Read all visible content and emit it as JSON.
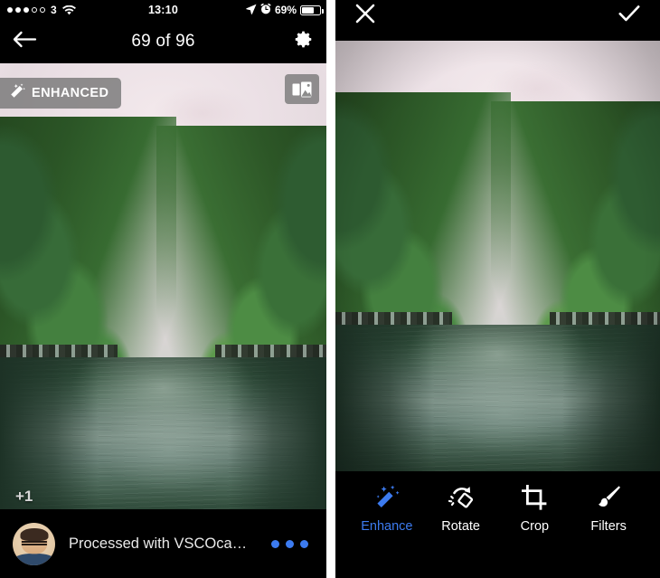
{
  "status_bar": {
    "signal_dots_filled": 3,
    "signal_dots_total": 5,
    "carrier": "3",
    "wifi_icon": "wifi-icon",
    "time": "13:10",
    "location_icon": "location-arrow-icon",
    "alarm_icon": "alarm-clock-icon",
    "battery_percent": "69%",
    "battery_level": 0.62
  },
  "left_panel": {
    "nav": {
      "back_icon": "arrow-left-icon",
      "title": "69 of 96",
      "settings_icon": "gear-icon"
    },
    "photo": {
      "enhanced_badge": {
        "icon": "magic-wand-icon",
        "label": "ENHANCED"
      },
      "photos_button_icon": "photo-stack-icon",
      "extra_count": "+1"
    },
    "caption_bar": {
      "avatar": "user-avatar",
      "caption": "Processed with VSCOcam wit…",
      "more_icon": "more-dots-icon"
    }
  },
  "right_panel": {
    "top_bar": {
      "cancel_icon": "close-x-icon",
      "confirm_icon": "checkmark-icon"
    },
    "toolbar": {
      "active_color": "#3c7bf0",
      "tools": [
        {
          "id": "enhance",
          "label": "Enhance",
          "icon": "magic-wand-icon",
          "active": true
        },
        {
          "id": "rotate",
          "label": "Rotate",
          "icon": "rotate-icon",
          "active": false
        },
        {
          "id": "crop",
          "label": "Crop",
          "icon": "crop-icon",
          "active": false
        },
        {
          "id": "filters",
          "label": "Filters",
          "icon": "brush-icon",
          "active": false
        }
      ]
    }
  },
  "colors": {
    "accent_blue": "#3c7bf0",
    "background": "#000000",
    "badge_gray": "rgba(118,118,118,0.8)"
  }
}
